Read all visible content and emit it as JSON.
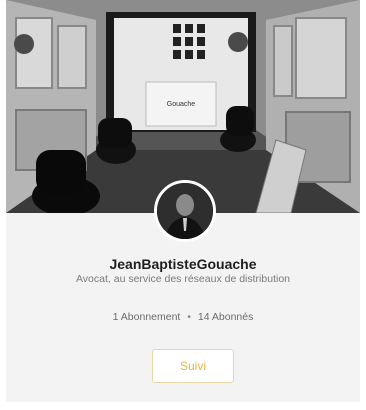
{
  "profile": {
    "name": "JeanBaptisteGouache",
    "tagline": "Avocat, au service des réseaux de distribution",
    "stats": {
      "following": "1 Abonnement",
      "separator": "•",
      "followers": "14 Abonnés"
    },
    "follow_button": "Suivi",
    "cover_sign_text": "Gouache"
  },
  "colors": {
    "accent": "#e9b54a",
    "button_border": "#ead9a8",
    "card_background": "#f3f3f3"
  }
}
